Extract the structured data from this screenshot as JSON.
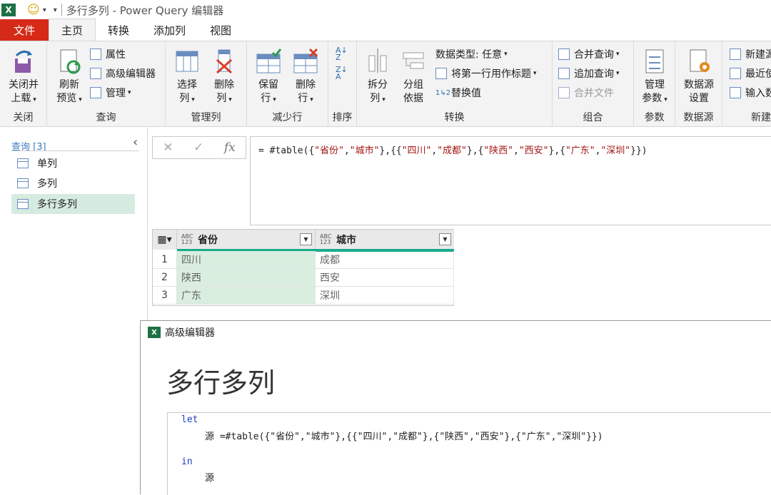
{
  "window": {
    "title": "多行多列 - Power Query 编辑器"
  },
  "tabs": [
    "文件",
    "主页",
    "转换",
    "添加列",
    "视图"
  ],
  "ribbon": {
    "close": {
      "btn1": "关闭并",
      "btn2": "上载",
      "group": "关闭"
    },
    "query": {
      "refresh1": "刷新",
      "refresh2": "预览",
      "properties": "属性",
      "advanced": "高级编辑器",
      "manage": "管理",
      "group": "查询"
    },
    "manage_cols": {
      "choose1": "选择",
      "choose2": "列",
      "remove1": "删除",
      "remove2": "列",
      "group": "管理列"
    },
    "reduce_rows": {
      "keep1": "保留",
      "keep2": "行",
      "remove1": "删除",
      "remove2": "行",
      "group": "减少行"
    },
    "sort": {
      "group": "排序"
    },
    "transform": {
      "split1": "拆分",
      "split2": "列",
      "groupby1": "分组",
      "groupby2": "依据",
      "datatype": "数据类型: 任意",
      "first_row": "将第一行用作标题",
      "replace": "替换值",
      "group": "转换"
    },
    "combine": {
      "merge": "合并查询",
      "append": "追加查询",
      "merge_files": "合并文件",
      "group": "组合"
    },
    "params": {
      "manage1": "管理",
      "manage2": "参数",
      "group": "参数"
    },
    "datasource": {
      "settings1": "数据源",
      "settings2": "设置",
      "group": "数据源"
    },
    "new": {
      "new_source": "新建源",
      "recent": "最近使",
      "enter": "输入数",
      "group": "新建"
    }
  },
  "queries": {
    "header": "查询 [3]",
    "items": [
      "单列",
      "多列",
      "多行多列"
    ]
  },
  "formula_bar": {
    "cancel": "✕",
    "confirm": "✓",
    "fx": "fx",
    "p1": "= #table({",
    "s1": "\"省份\"",
    "c1": ",",
    "s2": "\"城市\"",
    "p2": "},{{",
    "s3": "\"四川\"",
    "c2": ",",
    "s4": "\"成都\"",
    "p3": "},{",
    "s5": "\"陕西\"",
    "c3": ",",
    "s6": "\"西安\"",
    "p4": "},{",
    "s7": "\"广东\"",
    "c4": ",",
    "s8": "\"深圳\"",
    "p5": "}})"
  },
  "table": {
    "columns": [
      {
        "type": "ABC 123",
        "name": "省份"
      },
      {
        "type": "ABC 123",
        "name": "城市"
      }
    ],
    "rows": [
      {
        "n": "1",
        "c1": "四川",
        "c2": "成都"
      },
      {
        "n": "2",
        "c1": "陕西",
        "c2": "西安"
      },
      {
        "n": "3",
        "c1": "广东",
        "c2": "深圳"
      }
    ]
  },
  "advanced_editor": {
    "window_title": "高级编辑器",
    "query_name": "多行多列",
    "code": {
      "let": "let",
      "line2_name": "源 =",
      "line2_expr": "#table({\"省份\",\"城市\"},{{\"四川\",\"成都\"},{\"陕西\",\"西安\"},{\"广东\",\"深圳\"}})",
      "in": "in",
      "line4": "源"
    }
  },
  "colors": {
    "file_tab": "#d62a18",
    "selected_query": "#d5ebdf",
    "quality_bar": "#1aab8b",
    "keyword": "#1f3fbf",
    "string": "#a31515"
  }
}
